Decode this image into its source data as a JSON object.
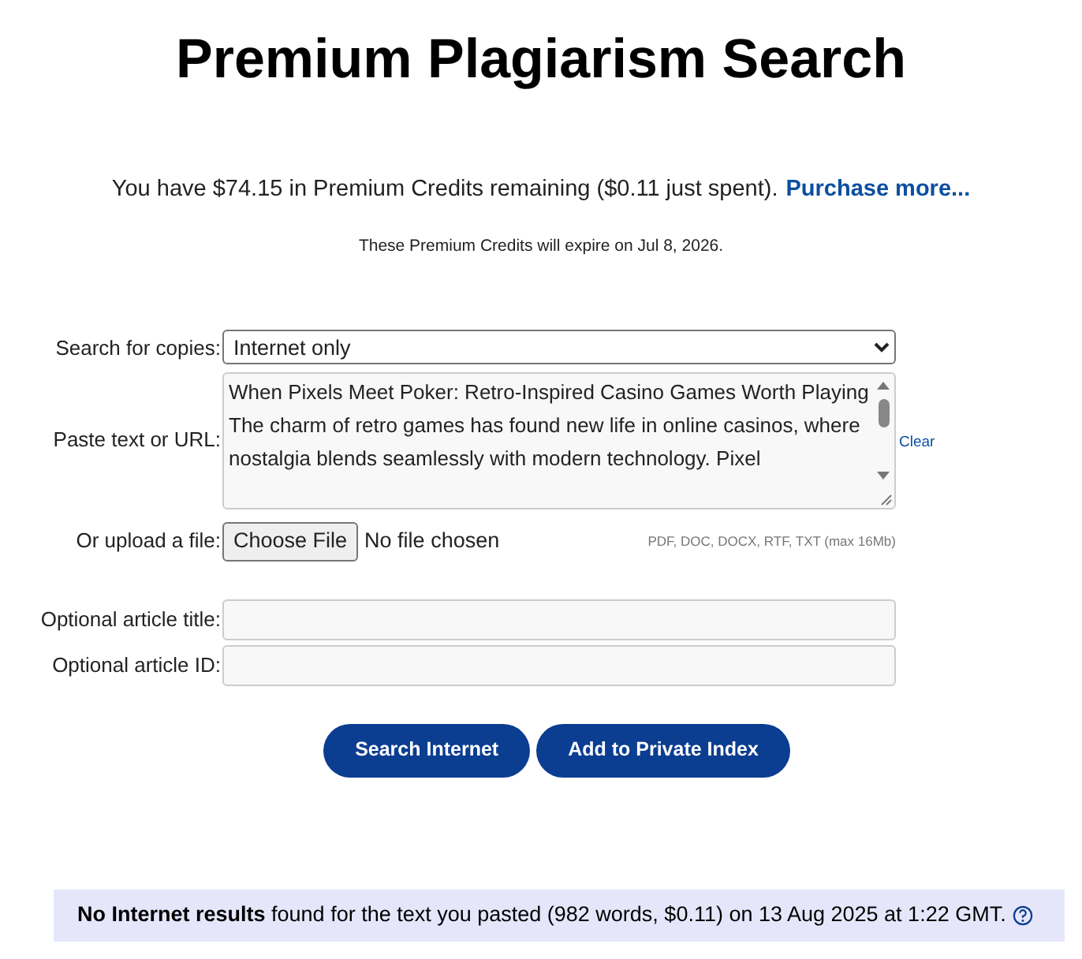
{
  "title": "Premium Plagiarism Search",
  "credits": {
    "text": "You have $74.15 in Premium Credits remaining ($0.11 just spent).",
    "link": "Purchase more...",
    "expiry": "These Premium Credits will expire on Jul 8, 2026."
  },
  "form": {
    "search_for": {
      "label": "Search for copies:",
      "value": "Internet only"
    },
    "paste": {
      "label": "Paste text or URL:",
      "value": "When Pixels Meet Poker: Retro-Inspired Casino Games Worth Playing\nThe charm of retro games has found new life in online casinos, where nostalgia blends seamlessly with modern technology. Pixel",
      "clear": "Clear"
    },
    "upload": {
      "label": "Or upload a file:",
      "button": "Choose File",
      "status": "No file chosen",
      "hint": "PDF, DOC, DOCX, RTF, TXT (max 16Mb)"
    },
    "fields": [
      {
        "label": "Optional article title:"
      },
      {
        "label": "Optional article ID:"
      }
    ],
    "buttons": [
      "Search Internet",
      "Add to Private Index"
    ]
  },
  "result": {
    "text": "**No Internet results** found for the text you pasted (982 words, $0.11) on 13 Aug 2025 at 1:22 GMT."
  }
}
